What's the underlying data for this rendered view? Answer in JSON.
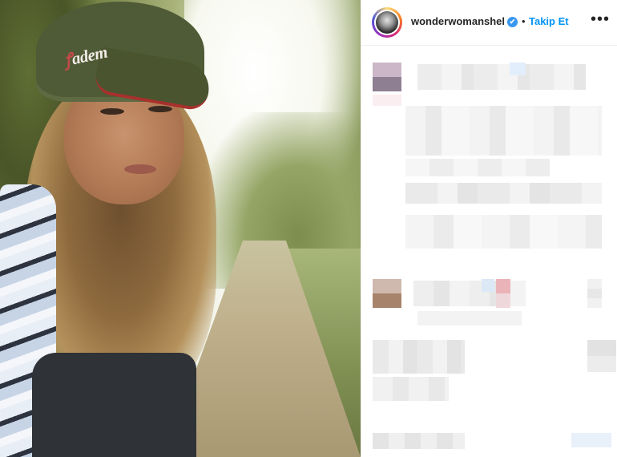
{
  "post": {
    "username": "wonderwomanshel",
    "follow_label": "Takip Et",
    "separator": "•",
    "more_label": "•••",
    "verified_glyph": "✔",
    "cap_logo_text": "dem",
    "cap_logo_mark": "a",
    "photo_alt": "photo-post",
    "icons": {
      "verified": "verified-badge-icon",
      "more": "more-options-icon"
    },
    "colors": {
      "follow": "#0095f6",
      "verified": "#3897f0",
      "text": "#262626"
    }
  }
}
